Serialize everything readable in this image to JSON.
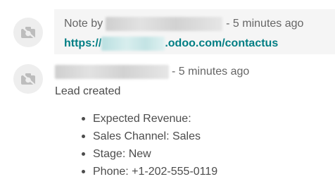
{
  "messages": [
    {
      "prefix": "Note by",
      "time": "- 5 minutes ago",
      "link_start": "https://",
      "link_end": ".odoo.com/contactus"
    },
    {
      "time": "- 5 minutes ago",
      "body": "Lead created",
      "details": [
        {
          "label": "Expected Revenue:"
        },
        {
          "label": "Sales Channel: Sales"
        },
        {
          "label": "Stage: New"
        },
        {
          "label": "Phone: +1-202-555-0119"
        }
      ]
    }
  ],
  "icons": {
    "avatar": "camera-slash-icon"
  },
  "colors": {
    "link": "#017e84",
    "note_background": "#f5f5f5",
    "muted_text": "#666666",
    "body_text": "#4c4c4c"
  }
}
